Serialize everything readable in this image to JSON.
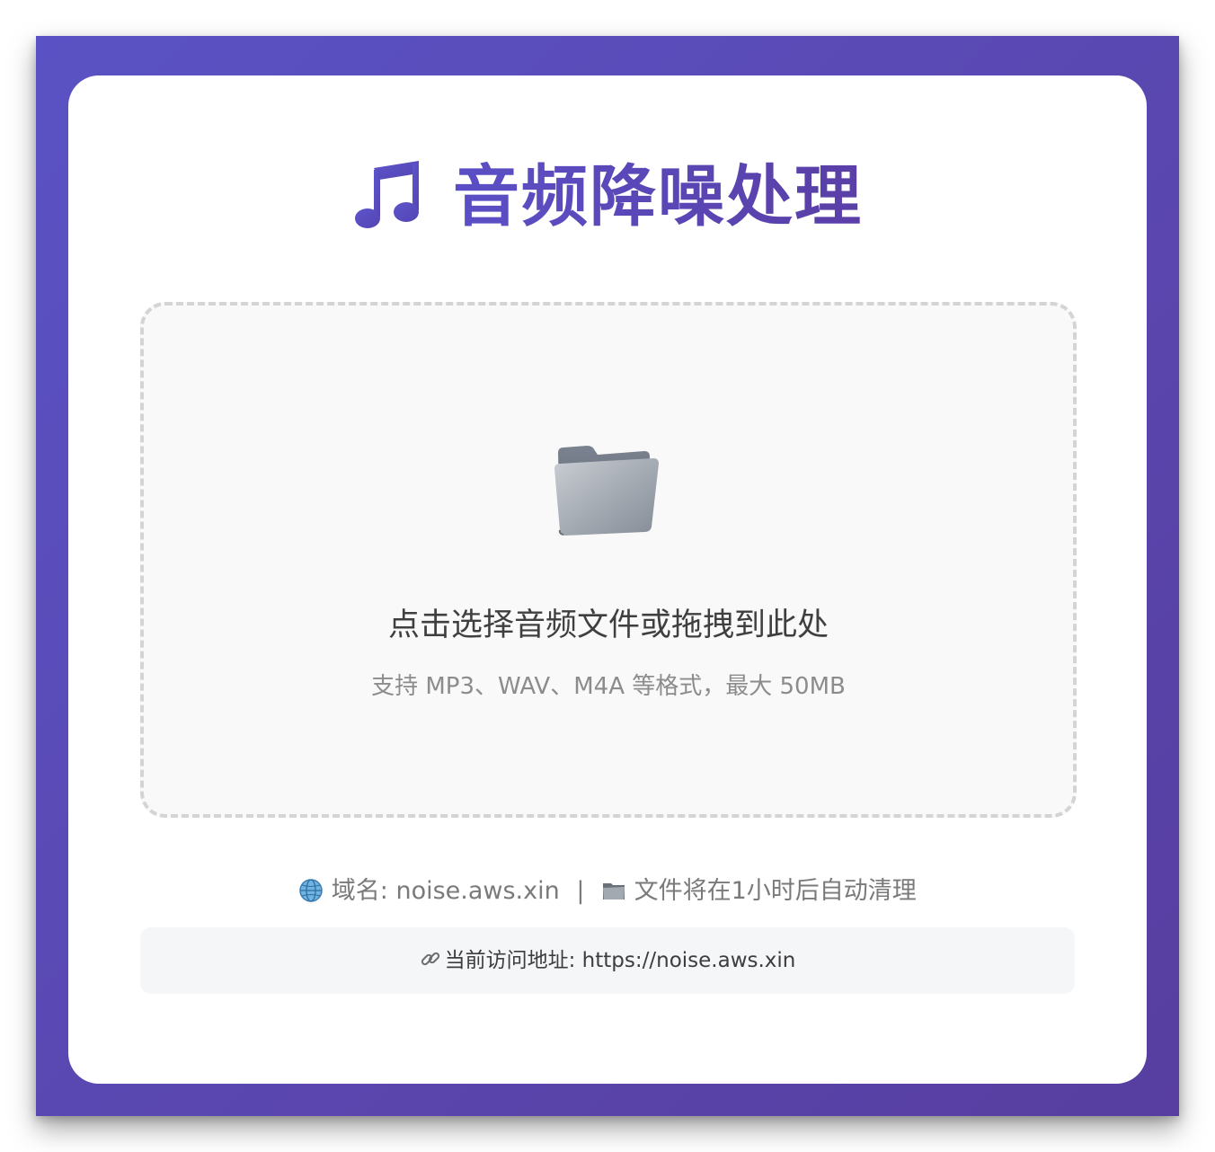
{
  "header": {
    "icon": "music-note-icon",
    "title": "音频降噪处理",
    "accent_color": "#5a48bb"
  },
  "upload": {
    "icon": "folder-icon",
    "prompt": "点击选择音频文件或拖拽到此处",
    "hint": "支持 MP3、WAV、M4A 等格式，最大 50MB"
  },
  "info": {
    "domain_icon": "globe-icon",
    "domain_text": "域名: noise.aws.xin",
    "separator": "|",
    "cleanup_icon": "folder-icon",
    "cleanup_text": "文件将在1小时后自动清理"
  },
  "access": {
    "icon": "link-icon",
    "label": "当前访问地址: ",
    "url": "https://noise.aws.xin"
  }
}
